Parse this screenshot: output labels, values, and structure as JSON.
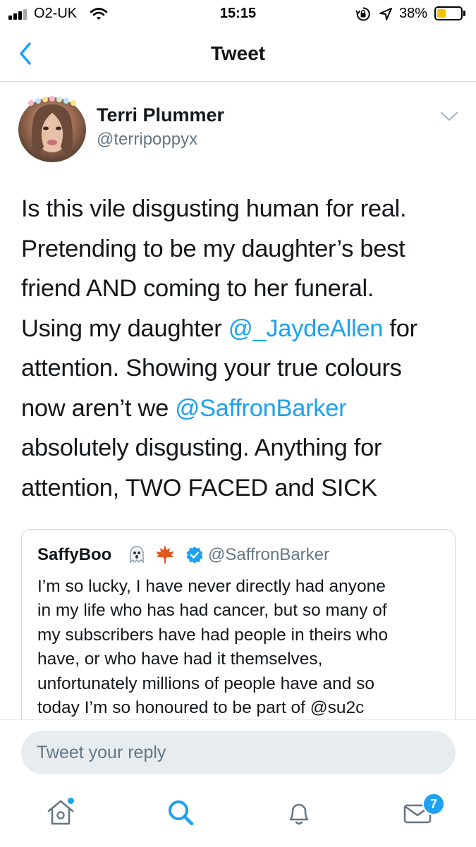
{
  "status_bar": {
    "carrier": "O2-UK",
    "time": "15:15",
    "battery_percent": "38%",
    "battery_level": 0.38,
    "icons": [
      "signal-bars-icon",
      "wifi-icon",
      "orientation-lock-icon",
      "location-arrow-icon",
      "battery-icon"
    ]
  },
  "nav": {
    "title": "Tweet",
    "back_icon": "chevron-left-icon"
  },
  "tweet": {
    "author_name": "Terri Plummer",
    "author_handle": "@terripoppyx",
    "menu_icon": "chevron-down-icon",
    "lines": [
      [
        {
          "t": "Is this vile disgusting human for real."
        }
      ],
      [
        {
          "t": "Pretending to be my daughter’s best"
        }
      ],
      [
        {
          "t": "friend AND coming to her funeral."
        }
      ],
      [
        {
          "t": "Using my daughter "
        },
        {
          "t": "@_JaydeAllen",
          "m": true
        },
        {
          "t": " for"
        }
      ],
      [
        {
          "t": "attention. Showing your true colours"
        }
      ],
      [
        {
          "t": "now aren’t we "
        },
        {
          "t": "@SaffronBarker",
          "m": true
        }
      ],
      [
        {
          "t": "absolutely disgusting. Anything for"
        }
      ],
      [
        {
          "t": "attention, TWO FACED and SICK"
        }
      ]
    ]
  },
  "quoted_tweet": {
    "author_name": "SaffyBoo",
    "author_handle": "@SaffronBarker",
    "name_emoji_icons": [
      "ghost-icon",
      "maple-leaf-icon"
    ],
    "verified_icon": "verified-badge-icon",
    "lines": [
      "I’m so lucky, I have never directly had anyone",
      "in my life who has had cancer, but so many of",
      "my subscribers have had people in theirs who",
      "have, or who have had it themselves,",
      "unfortunately millions of people have and so",
      "today I’m so honoured to be part of @su2c"
    ]
  },
  "reply": {
    "placeholder": "Tweet your reply"
  },
  "tab_bar": {
    "home_icon": "home-icon",
    "search_icon": "search-icon",
    "notifications_icon": "bell-icon",
    "messages_icon": "envelope-icon",
    "messages_badge": "7"
  },
  "colors": {
    "accent": "#1da1f2",
    "text": "#14171a",
    "secondary": "#657786",
    "divider": "#ccd6dd",
    "battery_fill": "#f5c400"
  }
}
